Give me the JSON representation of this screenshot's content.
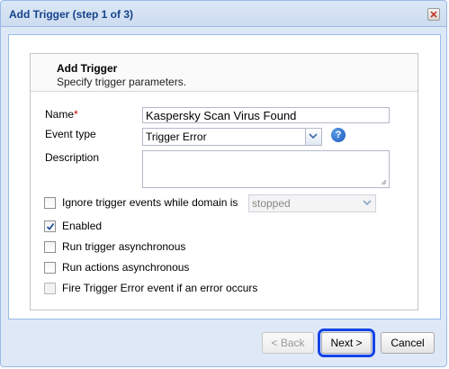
{
  "dialog": {
    "title": "Add Trigger (step 1 of 3)"
  },
  "header": {
    "title": "Add Trigger",
    "subtitle": "Specify trigger parameters."
  },
  "form": {
    "name_label": "Name",
    "name_required_marker": "*",
    "name_value": "Kaspersky Scan Virus Found",
    "event_type_label": "Event type",
    "event_type_value": "Trigger Error",
    "help_glyph": "?",
    "description_label": "Description",
    "description_value": "",
    "ignore_label": "Ignore trigger events while domain is",
    "ignore_checked": false,
    "domain_state_value": "stopped",
    "enabled_label": "Enabled",
    "enabled_checked": true,
    "run_trigger_async_label": "Run trigger asynchronous",
    "run_trigger_async_checked": false,
    "run_actions_async_label": "Run actions asynchronous",
    "run_actions_async_checked": false,
    "fire_error_label": "Fire Trigger Error event if an error occurs",
    "fire_error_checked": false
  },
  "buttons": {
    "back_label": "< Back",
    "next_label": "Next >",
    "cancel_label": "Cancel"
  },
  "colors": {
    "title_text": "#15428b",
    "required_marker": "#cc0000",
    "focus_outline": "#1443e6",
    "dialog_frame": "#99bbe8"
  },
  "icons": {
    "close": "close-icon",
    "dropdown": "chevron-down-icon",
    "help": "help-icon",
    "checkmark": "check-icon",
    "resize_grip": "resize-grip-icon"
  }
}
